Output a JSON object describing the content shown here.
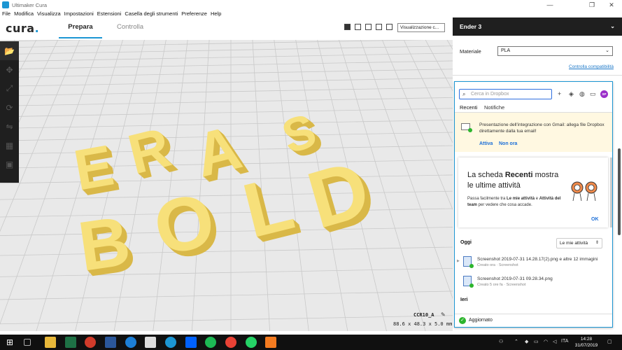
{
  "window": {
    "title": "Ultimaker Cura",
    "minimize": "—",
    "restore": "❐",
    "close": "✕"
  },
  "menu": [
    "File",
    "Modifica",
    "Visualizza",
    "Impostazioni",
    "Estensioni",
    "Casella degli strumenti",
    "Preferenze",
    "Help"
  ],
  "header": {
    "logo": "cura",
    "tab_prepare": "Prepara",
    "tab_monitor": "Controlla",
    "view_mode": "Visualizzazione c..."
  },
  "viewport": {
    "printer": "CCR10_A",
    "dimensions": "88.6 x 48.3 x 5.0 mm",
    "model_line1": [
      "E",
      "R",
      "A",
      "S"
    ],
    "model_line2": [
      "B",
      "O",
      "L",
      "D"
    ]
  },
  "right_panel": {
    "printer_name": "Ender 3",
    "material_label": "Materiale",
    "material_value": "PLA",
    "compat_link": "Controlla compatibilità"
  },
  "dropbox": {
    "search_placeholder": "Cerca in Dropbox",
    "avatar": "SP",
    "tab_recent": "Recenti",
    "tab_notifications": "Notifiche",
    "gmail_text": "Presentazione dell'integrazione con Gmail: allega file Dropbox direttamente dalla tua email!",
    "gmail_activate": "Attiva",
    "gmail_later": "Non ora",
    "card_headline_pre": "La scheda ",
    "card_headline_bold": "Recenti",
    "card_headline_post": " mostra le ultime attività",
    "card_desc_1": "Passa facilmente tra ",
    "card_desc_b1": "Le mie attività",
    "card_desc_2": " e ",
    "card_desc_b2": "Attività del team",
    "card_desc_3": " per vedere che cosa accade.",
    "card_ok": "OK",
    "today": "Oggi",
    "filter": "Le mie attività",
    "files": [
      {
        "name": "Screenshot 2019-07-31 14.28.17(2).png e altre 12 immagini",
        "meta": "Creato ora · Screenshot"
      },
      {
        "name": "Screenshot 2019-07-31 09.28.34.png",
        "meta": "Creato 5 ore fa · Screenshot"
      }
    ],
    "yesterday": "Ieri",
    "status": "Aggiornato"
  },
  "taskbar": {
    "time": "14:28",
    "date": "31/07/2019",
    "lang": "ITA"
  },
  "colors": {
    "accent": "#1c96d3",
    "model": "#f7e07a",
    "model_side": "#d9b848",
    "dark": "#1f1f1f"
  }
}
